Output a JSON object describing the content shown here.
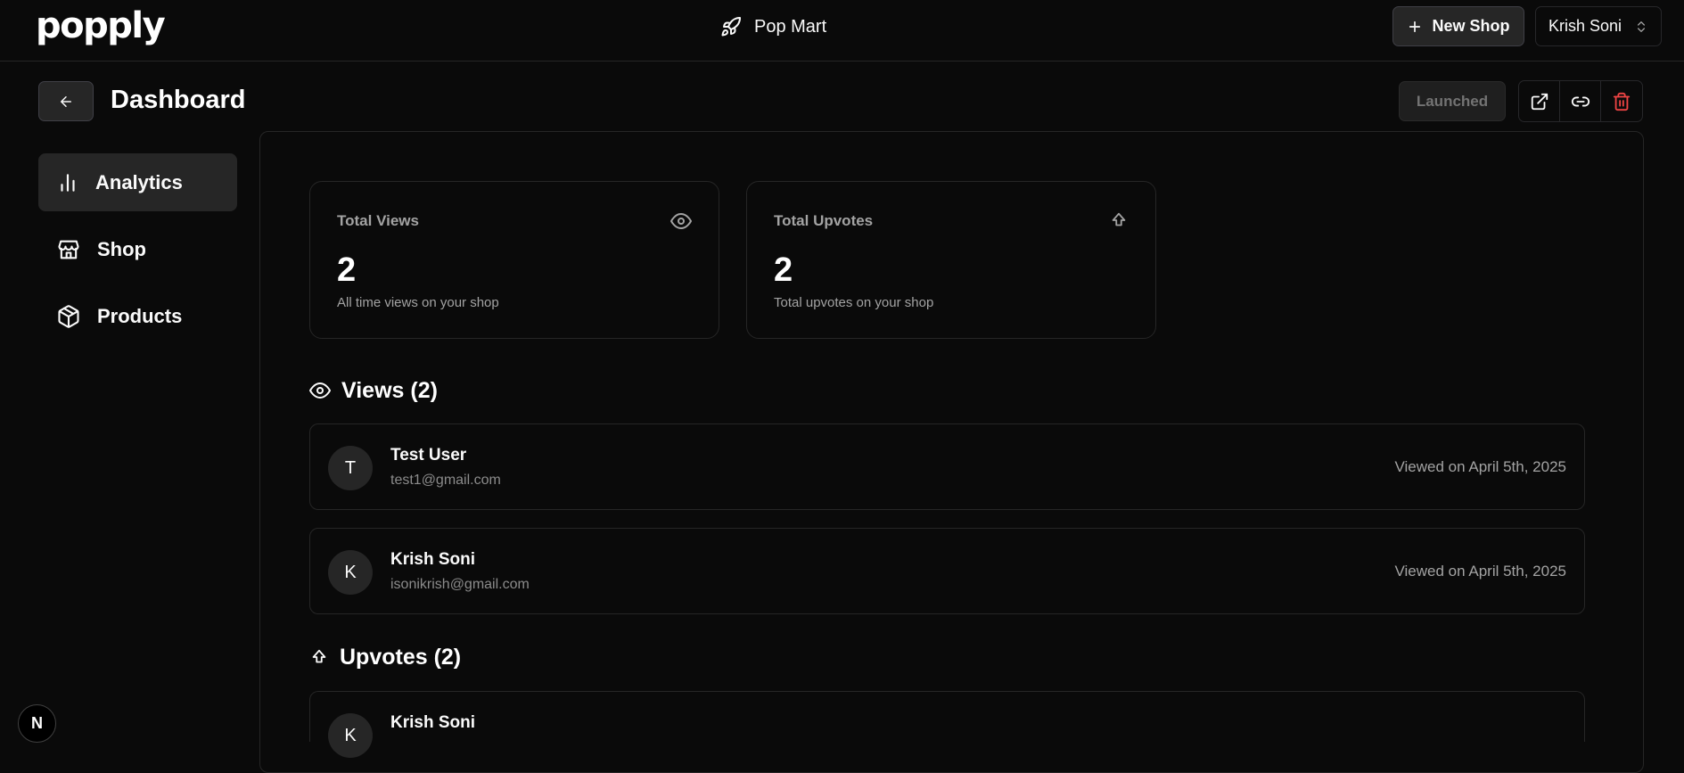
{
  "app": {
    "logo": "popply",
    "shop_name": "Pop Mart",
    "new_shop_label": "New Shop",
    "account_name": "Krish Soni",
    "next_badge": "N"
  },
  "header": {
    "title": "Dashboard",
    "status_label": "Launched"
  },
  "sidebar": {
    "items": [
      {
        "label": "Analytics",
        "icon": "bar-chart-icon",
        "active": true
      },
      {
        "label": "Shop",
        "icon": "store-icon",
        "active": false
      },
      {
        "label": "Products",
        "icon": "package-icon",
        "active": false
      }
    ]
  },
  "stats": [
    {
      "label": "Total Views",
      "icon": "eye-icon",
      "value": "2",
      "caption": "All time views on your shop"
    },
    {
      "label": "Total Upvotes",
      "icon": "arrow-up-icon",
      "value": "2",
      "caption": "Total upvotes on your shop"
    }
  ],
  "views": {
    "heading": "Views (2)",
    "rows": [
      {
        "initial": "T",
        "name": "Test User",
        "email": "test1@gmail.com",
        "date": "Viewed on April 5th, 2025"
      },
      {
        "initial": "K",
        "name": "Krish Soni",
        "email": "isonikrish@gmail.com",
        "date": "Viewed on April 5th, 2025"
      }
    ]
  },
  "upvotes": {
    "heading": "Upvotes (2)",
    "rows": [
      {
        "initial": "K",
        "name": "Krish Soni"
      }
    ]
  },
  "colors": {
    "background": "#0a0a0a",
    "border": "#262626",
    "danger": "#ef4444"
  }
}
